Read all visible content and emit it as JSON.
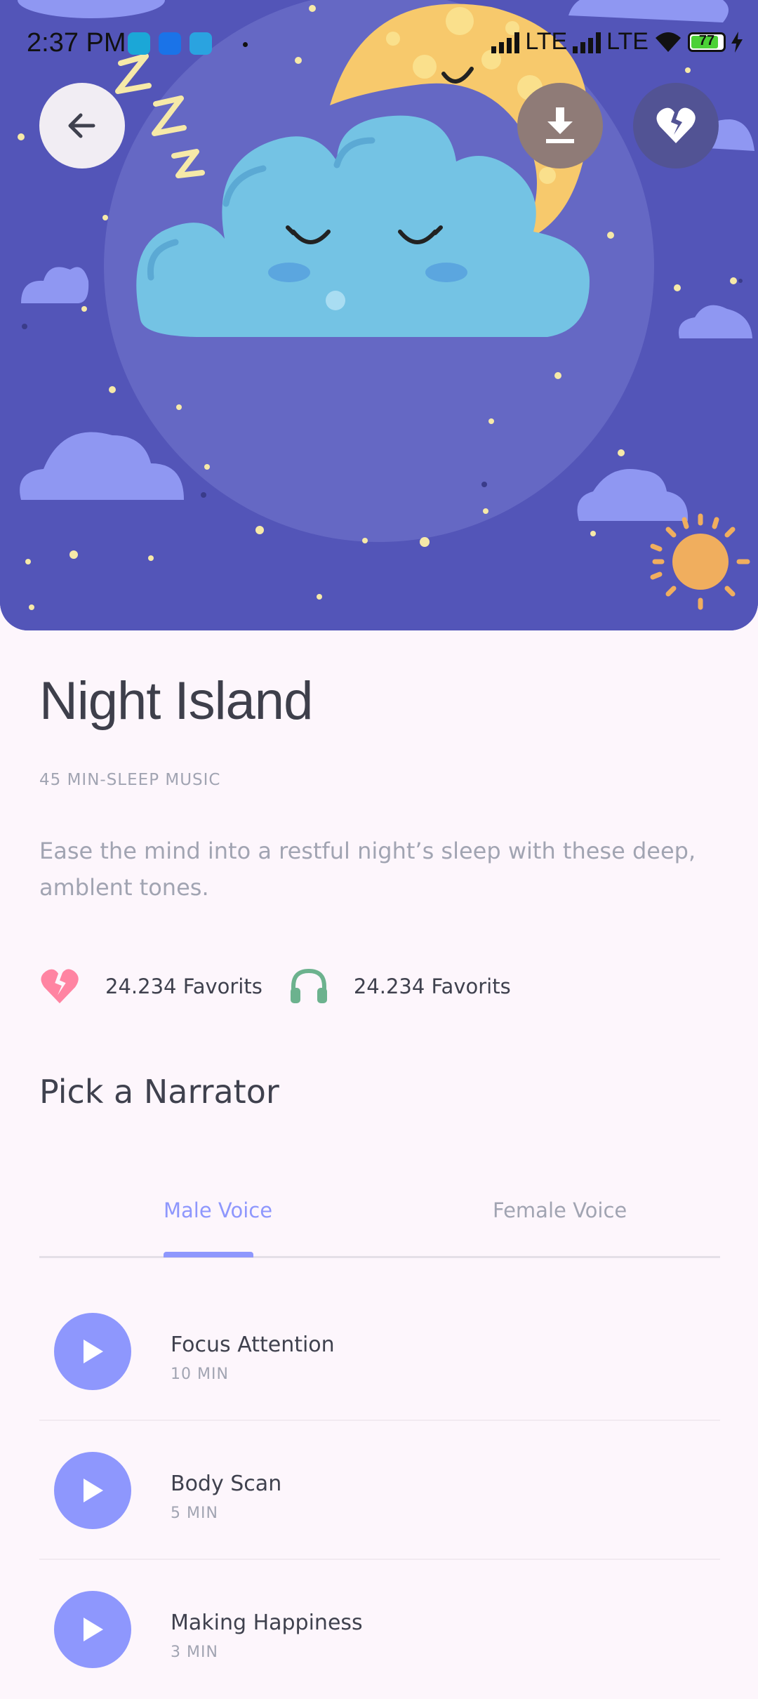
{
  "status_bar": {
    "time": "2:37 PM",
    "network1": "LTE",
    "network2": "LTE",
    "battery": "77"
  },
  "hero": {
    "background_color": "#5355B8",
    "illustration": "sleeping-cloud-moon-illustration"
  },
  "header_buttons": {
    "back_icon": "arrow-left-icon",
    "download_icon": "download-icon",
    "favorite_icon": "broken-heart-icon"
  },
  "content": {
    "title": "Night Island",
    "subtitle": "45 MIN-SLEEP MUSIC",
    "description": "Ease the mind into a restful night’s sleep  with these deep, amblent tones.",
    "stats": [
      {
        "icon": "broken-heart-icon",
        "text": "24.234 Favorits"
      },
      {
        "icon": "headphones-icon",
        "text": "24.234 Favorits"
      }
    ],
    "section_title": "Pick a Narrator"
  },
  "tabs": {
    "items": [
      {
        "label": "Male Voice",
        "active": true
      },
      {
        "label": "Female Voice",
        "active": false
      }
    ]
  },
  "tracks": [
    {
      "title": "Focus Attention",
      "duration": "10 MIN"
    },
    {
      "title": "Body Scan",
      "duration": "5 MIN"
    },
    {
      "title": "Making Happiness",
      "duration": "3 MIN"
    }
  ],
  "colors": {
    "accent": "#8E97FD",
    "text_dark": "#3F414E",
    "text_muted": "#A1A4B2",
    "heart": "#FF84A2",
    "headphones": "#6CB28E"
  }
}
